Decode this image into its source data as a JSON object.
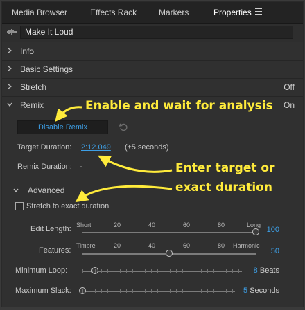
{
  "tabs": [
    {
      "label": "Media Browser",
      "active": false
    },
    {
      "label": "Effects Rack",
      "active": false
    },
    {
      "label": "Markers",
      "active": false
    },
    {
      "label": "Properties",
      "active": true
    }
  ],
  "clip": {
    "name": "Make It Loud",
    "icon": "waveform-icon"
  },
  "sections": {
    "info": {
      "label": "Info"
    },
    "basic_settings": {
      "label": "Basic Settings"
    },
    "stretch": {
      "label": "Stretch",
      "status": "Off"
    },
    "remix": {
      "label": "Remix",
      "status": "On"
    }
  },
  "remix": {
    "button_label": "Disable Remix",
    "target_duration_label": "Target Duration:",
    "target_duration_value": "2:12.049",
    "target_duration_hint": "(±5 seconds)",
    "remix_duration_label": "Remix Duration:",
    "remix_duration_value": "-",
    "advanced_label": "Advanced",
    "stretch_exact_label": "Stretch to exact duration",
    "stretch_exact_checked": false
  },
  "sliders": {
    "edit_length": {
      "label": "Edit Length:",
      "scale": [
        "Short",
        "20",
        "40",
        "60",
        "80",
        "Long"
      ],
      "value": "100",
      "fraction": 1.0
    },
    "features": {
      "label": "Features:",
      "scale": [
        "Timbre",
        "20",
        "40",
        "60",
        "80",
        "Harmonic"
      ],
      "value": "50",
      "fraction": 0.5
    },
    "minimum_loop": {
      "label": "Minimum Loop:",
      "value": "8",
      "unit": "Beats",
      "fraction": 0.08
    },
    "maximum_slack": {
      "label": "Maximum Slack:",
      "value": "5",
      "unit": "Seconds",
      "fraction": 0.0
    }
  },
  "annotations": {
    "enable": "Enable and wait for analysis",
    "enter_line1": "Enter target or",
    "enter_line2": "exact duration",
    "color": "#ffeb3b"
  },
  "colors": {
    "accent": "#3d9fe6",
    "panel": "#303030",
    "tabbar": "#232323"
  }
}
